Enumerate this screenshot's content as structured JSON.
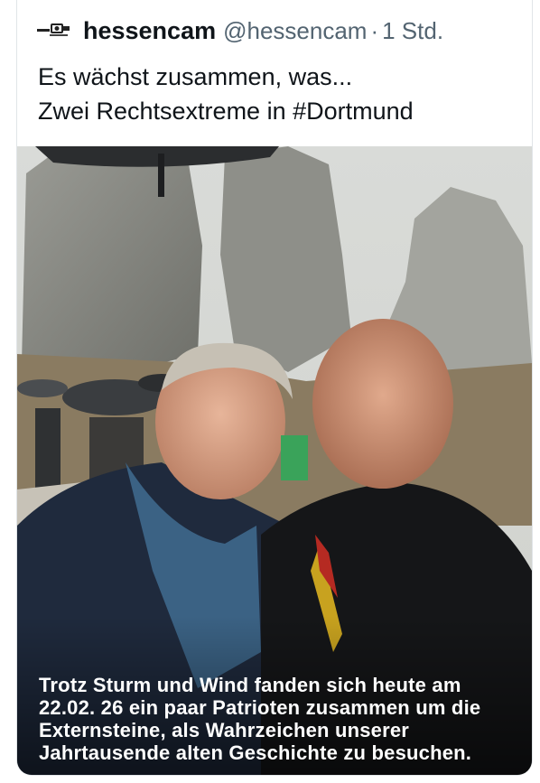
{
  "tweet": {
    "display_name": "hessencam",
    "handle": "@hessencam",
    "separator": "·",
    "time": "1 Std.",
    "avatar_icon": "hessencam-logo-icon",
    "text_lines": [
      "Es wächst zusammen, was...",
      "Zwei Rechtsextreme in #Dortmund"
    ]
  },
  "media": {
    "caption_lines": [
      "Trotz Sturm und Wind fanden sich heute am",
      "22.02. 26 ein paar Patrioten zusammen um die",
      "Externsteine, als Wahrzeichen unserer",
      "Jahrtausende alten Geschichte zu besuchen."
    ]
  }
}
